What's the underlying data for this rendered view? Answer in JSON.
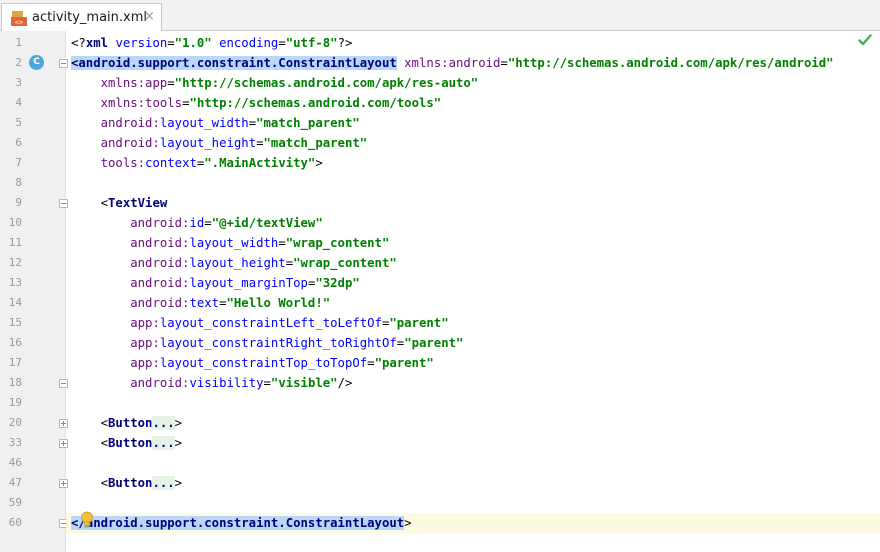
{
  "tab": {
    "title": "activity_main.xml",
    "close": "×"
  },
  "gutter": {
    "line_numbers": [
      "1",
      "2",
      "3",
      "4",
      "5",
      "6",
      "7",
      "8",
      "9",
      "10",
      "11",
      "12",
      "13",
      "14",
      "15",
      "16",
      "17",
      "18",
      "19",
      "20",
      "33",
      "46",
      "47",
      "59",
      "60"
    ],
    "class_badge": "C"
  },
  "code": {
    "lines": [
      [
        {
          "c": "pi",
          "t": "<?"
        },
        {
          "c": "tag",
          "t": "xml "
        },
        {
          "c": "attr",
          "t": "version"
        },
        {
          "c": "punc",
          "t": "="
        },
        {
          "c": "val",
          "t": "\"1.0\" "
        },
        {
          "c": "attr",
          "t": "encoding"
        },
        {
          "c": "punc",
          "t": "="
        },
        {
          "c": "val",
          "t": "\"utf-8\""
        },
        {
          "c": "pi",
          "t": "?>"
        }
      ],
      [
        {
          "c": "hl",
          "t": "<android.support.constraint.ConstraintLayout"
        },
        {
          "c": "punc",
          "t": " "
        },
        {
          "c": "ans",
          "t": "xmlns:android"
        },
        {
          "c": "punc",
          "t": "="
        },
        {
          "c": "val",
          "t": "\"http://schemas.android.com/apk/res/android\""
        }
      ],
      [
        {
          "c": "punc",
          "t": "    "
        },
        {
          "c": "ans",
          "t": "xmlns:app"
        },
        {
          "c": "punc",
          "t": "="
        },
        {
          "c": "val",
          "t": "\"http://schemas.android.com/apk/res-auto\""
        }
      ],
      [
        {
          "c": "punc",
          "t": "    "
        },
        {
          "c": "ans",
          "t": "xmlns:tools"
        },
        {
          "c": "punc",
          "t": "="
        },
        {
          "c": "val",
          "t": "\"http://schemas.android.com/tools\""
        }
      ],
      [
        {
          "c": "punc",
          "t": "    "
        },
        {
          "c": "ans",
          "t": "android:"
        },
        {
          "c": "attr",
          "t": "layout_width"
        },
        {
          "c": "punc",
          "t": "="
        },
        {
          "c": "val",
          "t": "\"match_parent\""
        }
      ],
      [
        {
          "c": "punc",
          "t": "    "
        },
        {
          "c": "ans",
          "t": "android:"
        },
        {
          "c": "attr",
          "t": "layout_height"
        },
        {
          "c": "punc",
          "t": "="
        },
        {
          "c": "val",
          "t": "\"match_parent\""
        }
      ],
      [
        {
          "c": "punc",
          "t": "    "
        },
        {
          "c": "ans",
          "t": "tools:"
        },
        {
          "c": "attr",
          "t": "context"
        },
        {
          "c": "punc",
          "t": "="
        },
        {
          "c": "val",
          "t": "\".MainActivity\""
        },
        {
          "c": "punc",
          "t": ">"
        }
      ],
      [],
      [
        {
          "c": "punc",
          "t": "    <"
        },
        {
          "c": "tag",
          "t": "TextView"
        }
      ],
      [
        {
          "c": "punc",
          "t": "        "
        },
        {
          "c": "ans",
          "t": "android:"
        },
        {
          "c": "attr",
          "t": "id"
        },
        {
          "c": "punc",
          "t": "="
        },
        {
          "c": "val",
          "t": "\"@+id/textView\""
        }
      ],
      [
        {
          "c": "punc",
          "t": "        "
        },
        {
          "c": "ans",
          "t": "android:"
        },
        {
          "c": "attr",
          "t": "layout_width"
        },
        {
          "c": "punc",
          "t": "="
        },
        {
          "c": "val",
          "t": "\"wrap_content\""
        }
      ],
      [
        {
          "c": "punc",
          "t": "        "
        },
        {
          "c": "ans",
          "t": "android:"
        },
        {
          "c": "attr",
          "t": "layout_height"
        },
        {
          "c": "punc",
          "t": "="
        },
        {
          "c": "val",
          "t": "\"wrap_content\""
        }
      ],
      [
        {
          "c": "punc",
          "t": "        "
        },
        {
          "c": "ans",
          "t": "android:"
        },
        {
          "c": "attr",
          "t": "layout_marginTop"
        },
        {
          "c": "punc",
          "t": "="
        },
        {
          "c": "val",
          "t": "\"32dp\""
        }
      ],
      [
        {
          "c": "punc",
          "t": "        "
        },
        {
          "c": "ans",
          "t": "android:"
        },
        {
          "c": "attr",
          "t": "text"
        },
        {
          "c": "punc",
          "t": "="
        },
        {
          "c": "val",
          "t": "\"Hello World!\""
        }
      ],
      [
        {
          "c": "punc",
          "t": "        "
        },
        {
          "c": "ans",
          "t": "app:"
        },
        {
          "c": "attr",
          "t": "layout_constraintLeft_toLeftOf"
        },
        {
          "c": "punc",
          "t": "="
        },
        {
          "c": "val",
          "t": "\"parent\""
        }
      ],
      [
        {
          "c": "punc",
          "t": "        "
        },
        {
          "c": "ans",
          "t": "app:"
        },
        {
          "c": "attr",
          "t": "layout_constraintRight_toRightOf"
        },
        {
          "c": "punc",
          "t": "="
        },
        {
          "c": "val",
          "t": "\"parent\""
        }
      ],
      [
        {
          "c": "punc",
          "t": "        "
        },
        {
          "c": "ans",
          "t": "app:"
        },
        {
          "c": "attr",
          "t": "layout_constraintTop_toTopOf"
        },
        {
          "c": "punc",
          "t": "="
        },
        {
          "c": "val",
          "t": "\"parent\""
        }
      ],
      [
        {
          "c": "punc",
          "t": "        "
        },
        {
          "c": "ans",
          "t": "android:"
        },
        {
          "c": "attr",
          "t": "visibility"
        },
        {
          "c": "punc",
          "t": "="
        },
        {
          "c": "val",
          "t": "\"visible\""
        },
        {
          "c": "punc",
          "t": "/>"
        }
      ],
      [],
      [
        {
          "c": "punc",
          "t": "    <"
        },
        {
          "c": "tag",
          "t": "Button"
        },
        {
          "c": "fold",
          "t": "..."
        },
        {
          "c": "punc",
          "t": ">"
        }
      ],
      [
        {
          "c": "punc",
          "t": "    <"
        },
        {
          "c": "tag",
          "t": "Button"
        },
        {
          "c": "fold",
          "t": "..."
        },
        {
          "c": "punc",
          "t": ">"
        }
      ],
      [],
      [
        {
          "c": "punc",
          "t": "    <"
        },
        {
          "c": "tag",
          "t": "Button"
        },
        {
          "c": "fold",
          "t": "..."
        },
        {
          "c": "punc",
          "t": ">"
        }
      ],
      [],
      [
        {
          "c": "hl",
          "t": "</android.support.constraint.ConstraintLayout"
        },
        {
          "c": "punc",
          "t": ">"
        }
      ]
    ]
  },
  "colors": {
    "tag": "#000080",
    "attribute": "#0000ff",
    "namespace": "#660e7a",
    "value": "#008000",
    "tag_highlight": "#b9d7f6",
    "current_line": "#fcfae1",
    "gutter": "#f0f0f0"
  }
}
